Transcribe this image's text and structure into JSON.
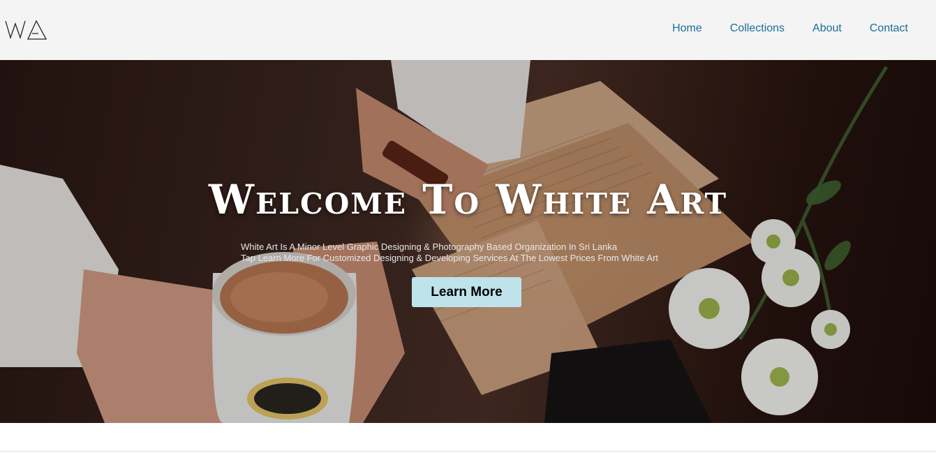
{
  "header": {
    "logo_alt": "WA",
    "nav": [
      {
        "label": "Home"
      },
      {
        "label": "Collections"
      },
      {
        "label": "About"
      },
      {
        "label": "Contact"
      }
    ],
    "link_color": "#1a6f98"
  },
  "hero": {
    "title": "Welcome To White Art",
    "description_line1": "White Art Is A Minor Level Graphic Designing & Photography Based Organization In Sri Lanka",
    "description_line2": "Tap Learn More For Customized Designing & Developing Services At The Lowest Prices From White Art",
    "cta_label": "Learn More",
    "cta_color": "#bfe3ea",
    "background_image": "photo of hands holding a coffee mug beside an open book and white daisies"
  }
}
